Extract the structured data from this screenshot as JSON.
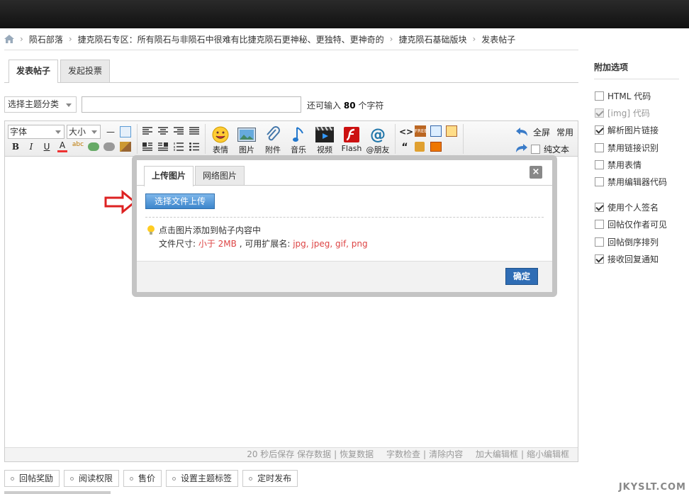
{
  "breadcrumb": [
    "陨石部落",
    "捷克陨石专区：所有陨石与非陨石中很难有比捷克陨石更神秘、更独特、更神奇的",
    "捷克陨石基础版块",
    "发表帖子"
  ],
  "tabs": {
    "post": "发表帖子",
    "poll": "发起投票"
  },
  "category": {
    "label": "选择主题分类"
  },
  "char_hint": {
    "prefix": "还可输入",
    "count": "80",
    "suffix": "个字符"
  },
  "toolbar": {
    "font": "字体",
    "size": "大小",
    "buttons": {
      "emoji": "表情",
      "image": "图片",
      "attach": "附件",
      "music": "音乐",
      "video": "视频",
      "flash": "Flash",
      "at": "@朋友"
    },
    "fullscreen": "全屏",
    "common": "常用",
    "plain": "纯文本"
  },
  "statusbar": {
    "autosave": "20 秒后保存",
    "save": "保存数据",
    "restore": "恢复数据",
    "count": "字数检查",
    "clear": "清除内容",
    "enlarge": "加大编辑框",
    "shrink": "缩小编辑框"
  },
  "modal": {
    "tab_upload": "上传图片",
    "tab_web": "网络图片",
    "close": "×",
    "upload_btn": "选择文件上传",
    "tip1": "点击图片添加到帖子内容中",
    "tip2_prefix": "文件尺寸: ",
    "tip2_size": "小于 2MB",
    "tip2_mid": " , 可用扩展名: ",
    "tip2_ext": "jpg, jpeg, gif, png",
    "ok": "确定"
  },
  "sidebar": {
    "title": "附加选项",
    "options": [
      {
        "label": "HTML 代码",
        "checked": false,
        "disabled": false
      },
      {
        "label": "[img] 代码",
        "checked": true,
        "disabled": true
      },
      {
        "label": "解析图片链接",
        "checked": true,
        "disabled": false
      },
      {
        "label": "禁用链接识别",
        "checked": false,
        "disabled": false
      },
      {
        "label": "禁用表情",
        "checked": false,
        "disabled": false
      },
      {
        "label": "禁用编辑器代码",
        "checked": false,
        "disabled": false
      },
      {
        "label": "使用个人签名",
        "checked": true,
        "disabled": false
      },
      {
        "label": "回帖仅作者可见",
        "checked": false,
        "disabled": false
      },
      {
        "label": "回帖倒序排列",
        "checked": false,
        "disabled": false
      },
      {
        "label": "接收回复通知",
        "checked": true,
        "disabled": false
      }
    ]
  },
  "bottom_tabs": [
    "回帖奖励",
    "阅读权限",
    "售价",
    "设置主题标签",
    "定时发布"
  ],
  "watermark": "JKYSLT.COM"
}
